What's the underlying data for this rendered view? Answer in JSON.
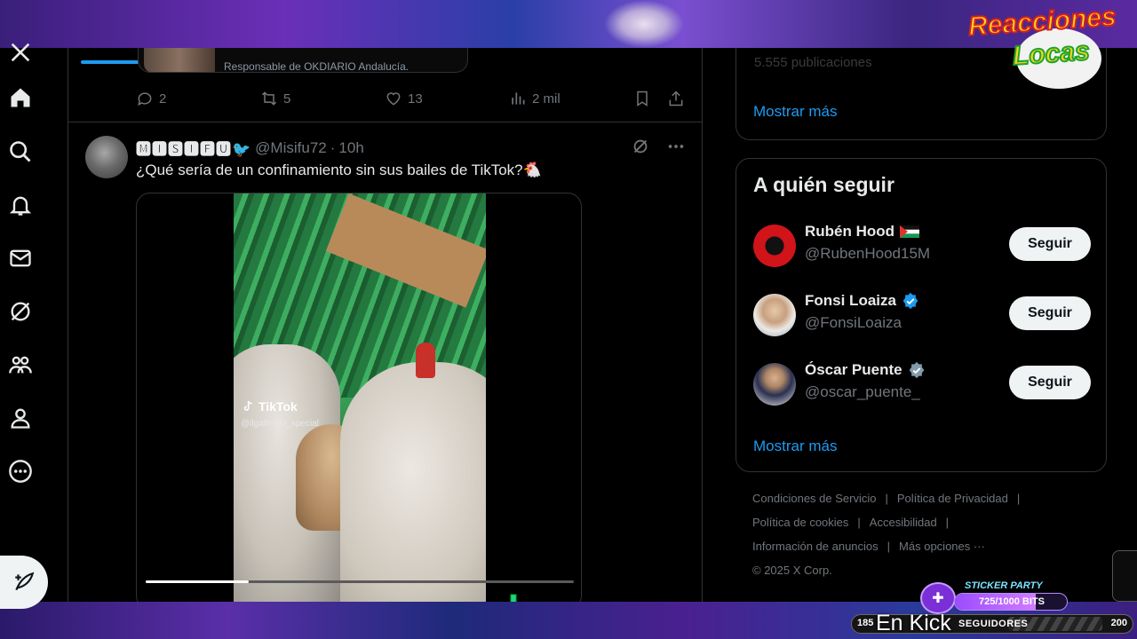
{
  "nav": {
    "items": [
      "home-icon",
      "search-icon",
      "bell-icon",
      "mail-icon",
      "grok-icon",
      "communities-icon",
      "profile-icon",
      "more-icon"
    ]
  },
  "prev_tweet": {
    "card_caption": "Responsable de OKDIARIO Andalucía.",
    "replies": "2",
    "reposts": "5",
    "likes": "13",
    "views": "2 mil"
  },
  "tweet": {
    "display_name": "🅼🅸🆂🅸🅵🆄🐦",
    "handle": "@Misifu72",
    "separator": "·",
    "time": "10h",
    "text": "¿Qué sería de un confinamiento sin sus bailes de TikTok?🐔",
    "video": {
      "watermark": "TikTok",
      "user": "@ilgallinaio_special",
      "progress": 0.24
    }
  },
  "sidebar": {
    "faded_text": "5.555 publicaciones",
    "show_more_1": "Mostrar más",
    "who_to_follow": {
      "title": "A quién seguir",
      "accounts": [
        {
          "name": "Rubén Hood",
          "badge": "flag",
          "handle": "@RubenHood15M",
          "button": "Seguir"
        },
        {
          "name": "Fonsi Loaiza",
          "badge": "verified",
          "handle": "@FonsiLoaiza",
          "button": "Seguir"
        },
        {
          "name": "Óscar Puente",
          "badge": "verified",
          "handle": "@oscar_puente_",
          "button": "Seguir"
        }
      ],
      "show_more": "Mostrar más"
    },
    "footer": {
      "terms": "Condiciones de Servicio",
      "privacy": "Política de Privacidad",
      "cookies": "Política de cookies",
      "accessibility": "Accesibilidad",
      "ads": "Información de anuncios",
      "more": "Más opciones ···",
      "copyright": "© 2025 X Corp."
    }
  },
  "stream": {
    "brand_line1": "Reacciones",
    "brand_line2": "Locas",
    "sticker_title": "STICKER PARTY",
    "sticker_progress": "725/1000 BITS",
    "sticker_fraction": 0.725,
    "goal_min": "185",
    "goal_label": "SEGUIDORES",
    "goal_max": "200",
    "kick_text": "En Kick"
  },
  "colors": {
    "accent": "#1d9bf0",
    "background": "#000000",
    "border": "#2f3336",
    "muted": "#71767b"
  }
}
